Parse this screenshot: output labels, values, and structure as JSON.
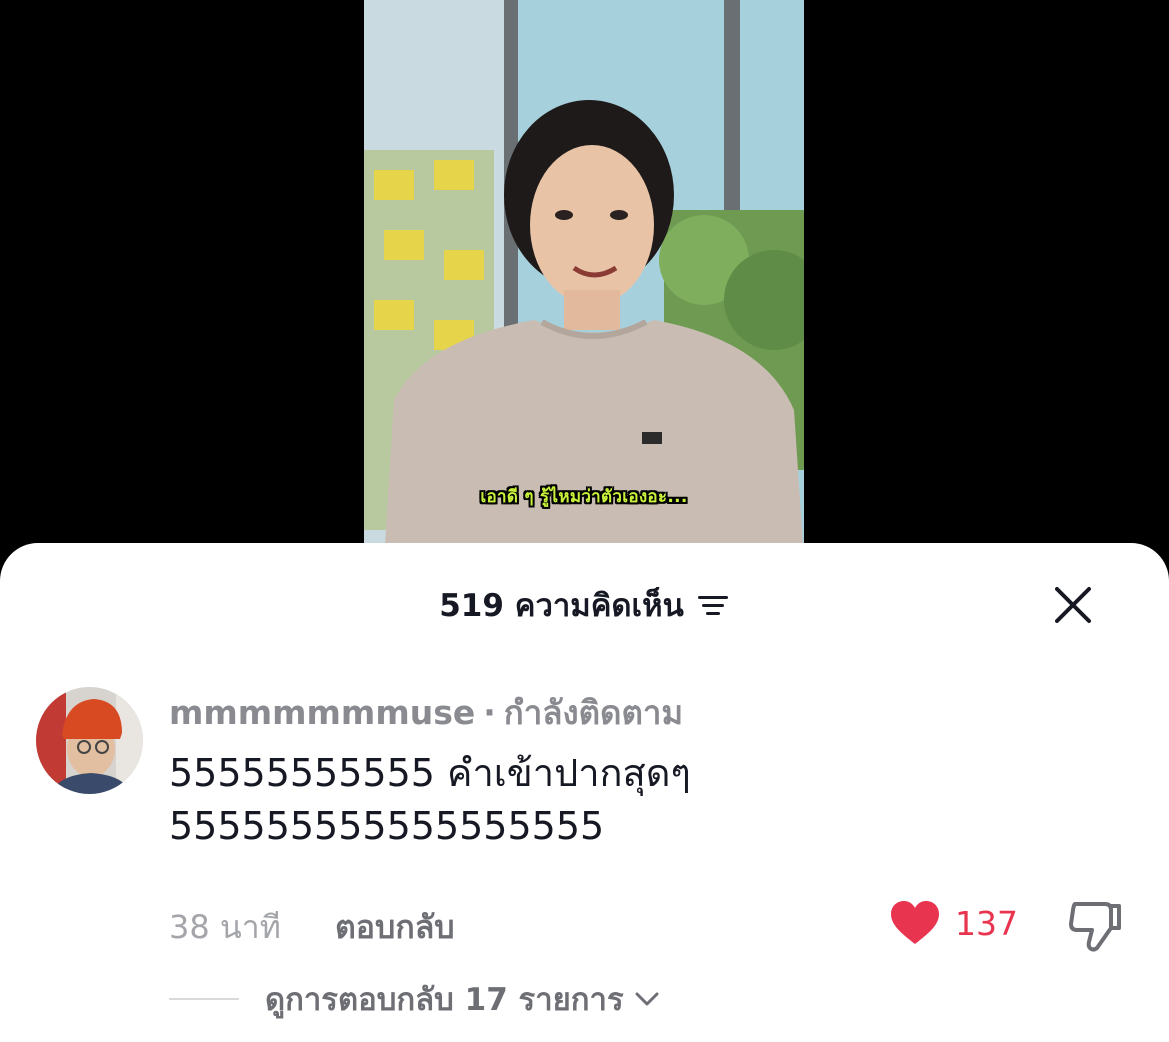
{
  "video": {
    "caption": "เอาดี ๆ รู้ไหมว่าตัวเองอะ..."
  },
  "comments_panel": {
    "title": "519 ความคิดเห็น",
    "filter_icon": "filter-lines-icon",
    "close_icon": "close-icon"
  },
  "comment": {
    "username": "mmmmmmmuse",
    "separator": "·",
    "follow_status": "กำลังติดตาม",
    "text_line1": "55555555555 คำเข้าปากสุดๆ",
    "text_line2": "555555555555555555",
    "time": "38 นาที",
    "reply_label": "ตอบกลับ",
    "like_count": "137",
    "like_icon": "heart-icon",
    "dislike_icon": "thumbs-down-icon",
    "view_replies_label": "ดูการตอบกลับ 17 รายการ",
    "like_color": "#e8344f"
  }
}
